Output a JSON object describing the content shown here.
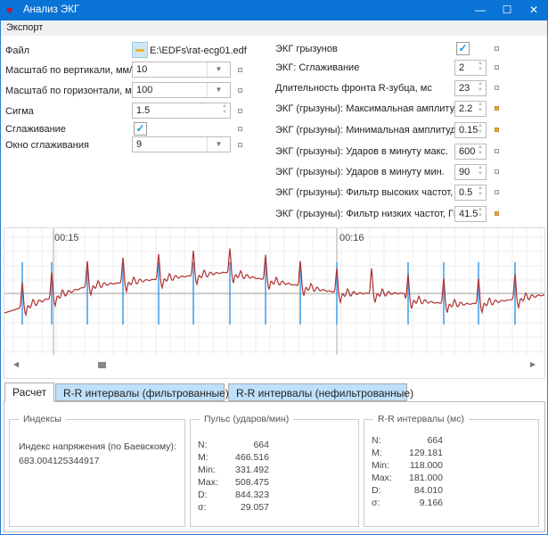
{
  "window": {
    "title": "Анализ ЭКГ",
    "icon": "heart-icon"
  },
  "menu": {
    "export": "Экспорт"
  },
  "left_form": {
    "file_label": "Файл",
    "file_value": "E:\\EDFs\\rat-ecg01.edf",
    "vscale_label": "Масштаб по вертикали, мм/мВ",
    "vscale_value": "10",
    "hscale_label": "Масштаб по горизонтали, мм/с",
    "hscale_value": "100",
    "sigma_label": "Сигма",
    "sigma_value": "1.5",
    "smoothing_label": "Сглаживание",
    "smoothing_checked": true,
    "window_label": "Окно сглаживания",
    "window_value": "9"
  },
  "right_form": [
    {
      "label": "ЭКГ грызунов",
      "type": "checkbox",
      "checked": true,
      "marker_active": false
    },
    {
      "label": "ЭКГ: Сглаживание",
      "value": "2",
      "marker_active": false
    },
    {
      "label": "Длительность фронта R-зубца, мс",
      "value": "23",
      "marker_active": false
    },
    {
      "label": "ЭКГ (грызуны): Максимальная амплитуда, мВ",
      "value": "2.2",
      "marker_active": true
    },
    {
      "label": "ЭКГ (грызуны): Минимальная амплитуда, мВ",
      "value": "0.15",
      "marker_active": true
    },
    {
      "label": "ЭКГ (грызуны): Ударов в минуту макс.",
      "value": "600",
      "marker_active": false
    },
    {
      "label": "ЭКГ (грызуны): Ударов в минуту мин.",
      "value": "90",
      "marker_active": false
    },
    {
      "label": "ЭКГ (грызуны): Фильтр высоких частот, Гц",
      "value": "0.5",
      "marker_active": false
    },
    {
      "label": "ЭКГ (грызуны): Фильтр низких частот, Гц",
      "value": "41.5",
      "marker_active": true
    }
  ],
  "ecg": {
    "time_labels": [
      "00:15",
      "00:16"
    ],
    "signal_color": "#b03030",
    "marker_color": "#3d9be9"
  },
  "tabs": [
    "Расчет",
    "R-R интервалы (фильтрованные)",
    "R-R интервалы (нефильтрованные)"
  ],
  "active_tab": 0,
  "indices": {
    "title": "Индексы",
    "label": "Индекс напряжения (по Баевскому):",
    "value": "683.004125344917"
  },
  "pulse": {
    "title": "Пульс (ударов/мин)",
    "rows": [
      [
        "N:",
        "664"
      ],
      [
        "M:",
        "466.516"
      ],
      [
        "Min:",
        "331.492"
      ],
      [
        "Max:",
        "508.475"
      ],
      [
        "D:",
        "844.323"
      ],
      [
        "σ:",
        "29.057"
      ]
    ]
  },
  "rr": {
    "title": "R-R интервалы (мс)",
    "rows": [
      [
        "N:",
        "664"
      ],
      [
        "M:",
        "129.181"
      ],
      [
        "Min:",
        "118.000"
      ],
      [
        "Max:",
        "181.000"
      ],
      [
        "D:",
        "84.010"
      ],
      [
        "σ:",
        "9.166"
      ]
    ]
  }
}
